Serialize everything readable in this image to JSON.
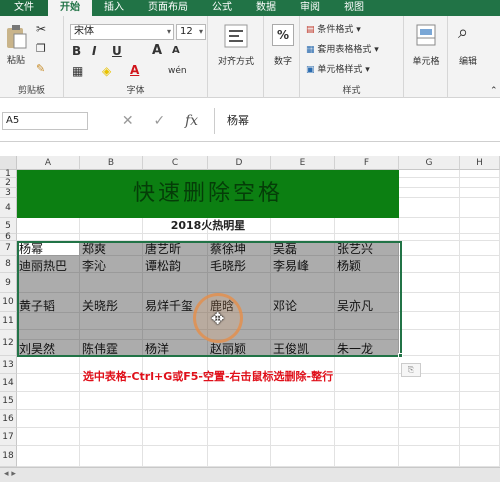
{
  "ribbon_tabs": [
    {
      "label": "文件",
      "active": false
    },
    {
      "label": "开始",
      "active": true
    },
    {
      "label": "插入",
      "active": false
    },
    {
      "label": "页面布局",
      "active": false
    },
    {
      "label": "公式",
      "active": false
    },
    {
      "label": "数据",
      "active": false
    },
    {
      "label": "审阅",
      "active": false
    },
    {
      "label": "视图",
      "active": false
    }
  ],
  "clipboard": {
    "paste": "粘贴",
    "group_label": "剪贴板"
  },
  "font": {
    "name": "宋体",
    "size": "12",
    "bold": "B",
    "italic": "I",
    "underline": "U",
    "grow": "A",
    "shrink": "A",
    "font_color_glyph": "A",
    "phonetic": "wén",
    "group_label": "字体"
  },
  "alignment": {
    "label": "对齐方式"
  },
  "number": {
    "glyph": "%",
    "label": "数字"
  },
  "styles": {
    "cond_fmt": "条件格式 ▾",
    "table_fmt": "套用表格格式 ▾",
    "cell_style": "单元格样式 ▾",
    "group_label": "样式"
  },
  "cells": {
    "label": "单元格"
  },
  "editing": {
    "label": "编辑"
  },
  "formula_bar": {
    "name_box": "A5",
    "cancel": "✕",
    "enter": "✓",
    "fx": "fx",
    "content": "杨幂"
  },
  "columns": [
    "A",
    "B",
    "C",
    "D",
    "E",
    "F",
    "G",
    "H"
  ],
  "rows": [
    "1",
    "2",
    "3",
    "4",
    "5",
    "6",
    "7",
    "8",
    "9",
    "10",
    "11",
    "12",
    "13",
    "14",
    "15",
    "16",
    "17",
    "18"
  ],
  "sheet": {
    "title": "快速删除空格",
    "subtitle": "2018火热明星",
    "table": [
      [
        "杨幂",
        "郑爽",
        "唐艺昕",
        "蔡徐坤",
        "吴磊",
        "张艺兴"
      ],
      [
        "迪丽热巴",
        "李沁",
        "谭松韵",
        "毛晓彤",
        "李易峰",
        "杨颖"
      ],
      [
        "",
        "",
        "",
        "",
        "",
        ""
      ],
      [
        "黄子韬",
        "关晓彤",
        "易烊千玺",
        "鹿晗",
        "邓论",
        "吴亦凡"
      ],
      [
        "",
        "",
        "",
        "",
        "",
        ""
      ],
      [
        "",
        "",
        "",
        "",
        "",
        ""
      ],
      [
        "刘昊然",
        "陈伟霆",
        "杨洋",
        "赵丽颖",
        "王俊凯",
        "朱一龙"
      ]
    ],
    "instruction": "选中表格-Ctrl+G或F5-空置-右击鼠标选删除-整行"
  },
  "colors": {
    "ribbon_green": "#217346",
    "title_fill": "#0c7f12",
    "table_fill": "#acacac",
    "instruction_red": "#e0101a"
  }
}
